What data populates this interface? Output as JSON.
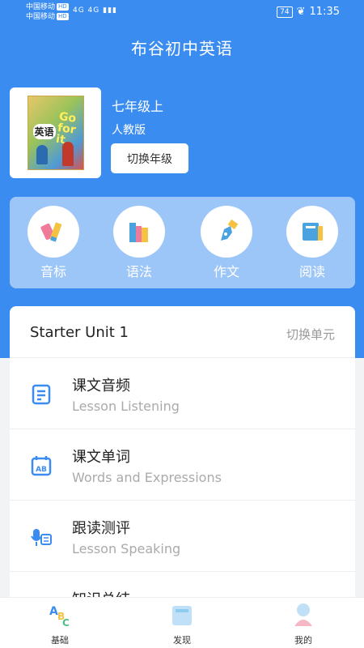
{
  "status_bar": {
    "carrier1": "中国移动",
    "carrier2": "中国移动",
    "hd": "HD",
    "signal": "4G 4G",
    "battery": "74",
    "time": "11:35"
  },
  "header": {
    "title": "布谷初中英语"
  },
  "book": {
    "grade": "七年级上",
    "edition": "人教版",
    "switch_label": "切换年级",
    "cover_title": "英语",
    "cover_slogan": "Go for it"
  },
  "features": [
    {
      "label": "音标",
      "icon": "pencil-eraser-icon"
    },
    {
      "label": "语法",
      "icon": "books-icon"
    },
    {
      "label": "作文",
      "icon": "pen-nib-icon"
    },
    {
      "label": "阅读",
      "icon": "book-icon"
    }
  ],
  "unit": {
    "name": "Starter Unit 1",
    "switch_label": "切换单元",
    "items": [
      {
        "title": "课文音频",
        "subtitle": "Lesson Listening",
        "icon": "document-icon"
      },
      {
        "title": "课文单词",
        "subtitle": "Words and Expressions",
        "icon": "calendar-ab-icon"
      },
      {
        "title": "跟读测评",
        "subtitle": "Lesson Speaking",
        "icon": "microphone-icon"
      },
      {
        "title": "知识总结",
        "subtitle": "",
        "icon": "summary-icon"
      }
    ]
  },
  "tabs": [
    {
      "label": "基础",
      "icon": "abc-icon"
    },
    {
      "label": "发现",
      "icon": "book-discover-icon"
    },
    {
      "label": "我的",
      "icon": "profile-icon"
    }
  ],
  "colors": {
    "primary": "#3b8cf0",
    "background": "#f2f3f5"
  }
}
